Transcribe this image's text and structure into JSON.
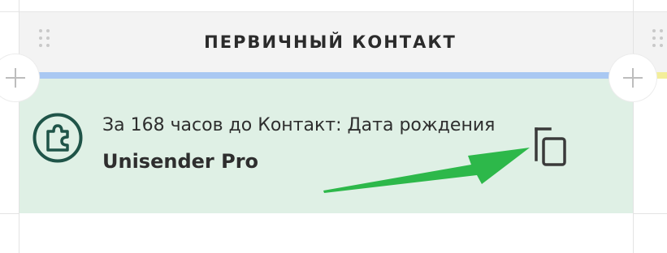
{
  "column": {
    "title": "ПЕРВИЧНЫЙ КОНТАКТ",
    "stage_color": "#a9c8f2",
    "next_stage_color": "#f3ee9a"
  },
  "card": {
    "trigger_text": "За 168 часов до Контакт: Дата рождения",
    "integration_name": "Unisender Pro",
    "background_color": "#dff0e5",
    "icon": "puzzle-icon",
    "action_icon": "copy-icon"
  },
  "annotation": {
    "arrow_color": "#2db84a",
    "icon": "green-arrow"
  },
  "icons": {
    "add": "plus-icon",
    "drag": "drag-handle-icon"
  }
}
